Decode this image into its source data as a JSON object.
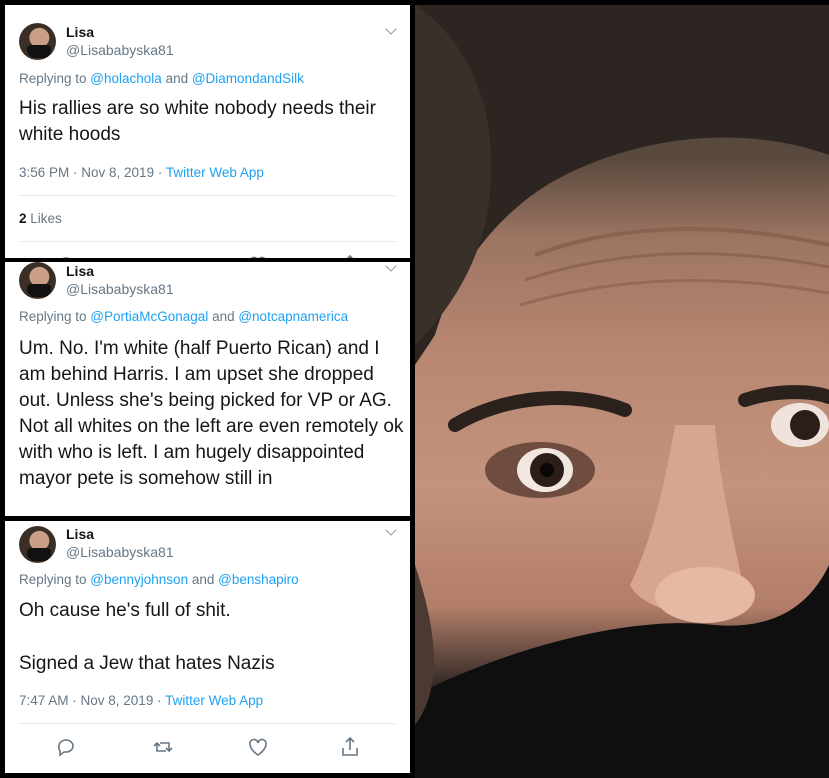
{
  "tweets": [
    {
      "name": "Lisa",
      "handle": "@Lisababyska81",
      "replying_prefix": "Replying to ",
      "mention1": "@holachola",
      "and": " and ",
      "mention2": "@DiamondandSilk",
      "text": "His rallies are so white nobody needs their white hoods",
      "time": "3:56 PM · Nov 8, 2019 · ",
      "app": "Twitter Web App",
      "likes_count": "2",
      "likes_label": " Likes"
    },
    {
      "name": "Lisa",
      "handle": "@Lisababyska81",
      "replying_prefix": "Replying to ",
      "mention1": "@PortiaMcGonagal",
      "and": " and ",
      "mention2": "@notcapnamerica",
      "text": "Um. No. I'm white (half Puerto Rican) and I am behind Harris.  I am upset she dropped out.  Unless she's being picked for VP or AG.  Not all whites on the left are even remotely ok with who is left.  I am hugely disappointed mayor pete is somehow still in"
    },
    {
      "name": "Lisa",
      "handle": "@Lisababyska81",
      "replying_prefix": "Replying to ",
      "mention1": "@bennyjohnson",
      "and": " and ",
      "mention2": "@benshapiro",
      "text_line1": "Oh cause he's full of shit.",
      "text_line2": "Signed a Jew that hates Nazis",
      "time": "7:47 AM · Nov 8, 2019 · ",
      "app": "Twitter Web App"
    }
  ],
  "icons": [
    "chevron-down-icon",
    "reply-icon",
    "retweet-icon",
    "like-icon",
    "share-icon"
  ],
  "colors": {
    "link": "#1da1f2",
    "muted": "#657786",
    "text": "#14171a"
  }
}
